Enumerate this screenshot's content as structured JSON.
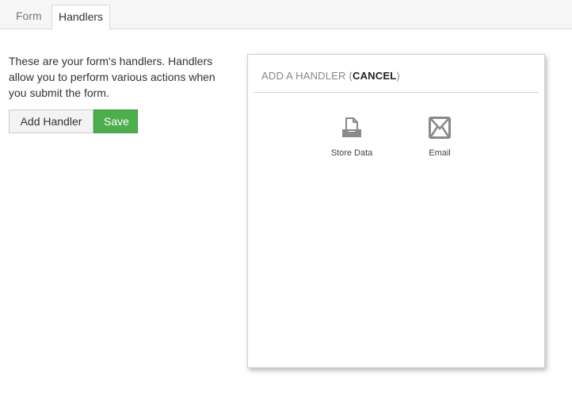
{
  "tabs": {
    "form_label": "Form",
    "handlers_label": "Handlers",
    "active": "Handlers"
  },
  "intro": {
    "text": "These are your form's handlers. Handlers allow you to perform various actions when you submit the form."
  },
  "buttons": {
    "add_handler_label": "Add Handler",
    "save_label": "Save"
  },
  "panel": {
    "title_prefix": "ADD A HANDLER (",
    "cancel_label": "CANCEL",
    "title_suffix": ")",
    "handlers": [
      {
        "label": "Store Data",
        "icon": "inbox-tray-icon"
      },
      {
        "label": "Email",
        "icon": "envelope-icon"
      }
    ]
  },
  "colors": {
    "save_button": "#4cae4c",
    "icon_gray": "#8a8a8a"
  }
}
